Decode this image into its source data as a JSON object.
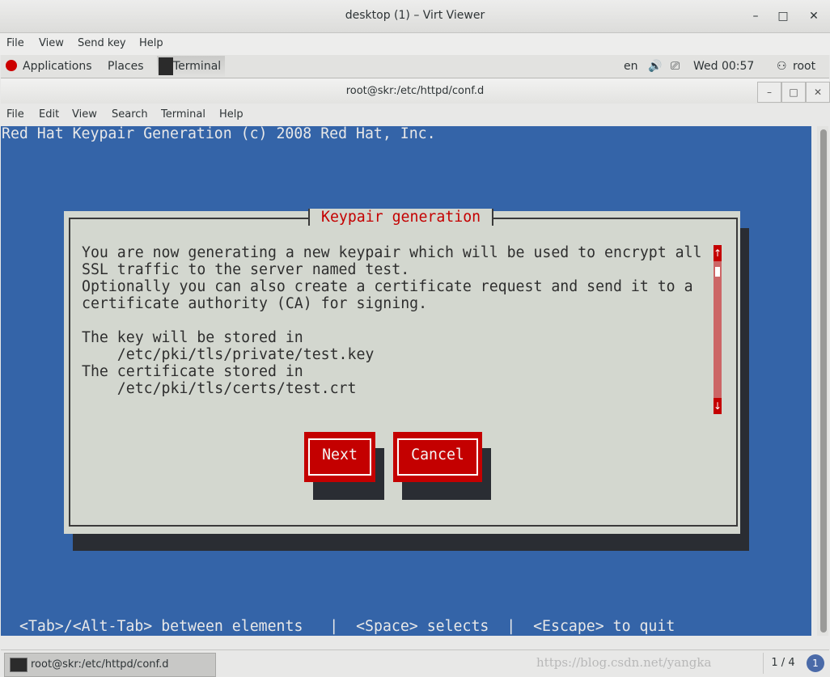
{
  "viewer": {
    "title": "desktop (1) – Virt Viewer",
    "menu": [
      "File",
      "View",
      "Send key",
      "Help"
    ]
  },
  "gnome_bar": {
    "applications": "Applications",
    "places": "Places",
    "task": "Terminal",
    "lang": "en",
    "clock": "Wed 00:57",
    "user": "root"
  },
  "terminal_window": {
    "title": "root@skr:/etc/httpd/conf.d",
    "menu": [
      "File",
      "Edit",
      "View",
      "Search",
      "Terminal",
      "Help"
    ]
  },
  "screen": {
    "header": "Red Hat Keypair Generation (c) 2008 Red Hat, Inc.",
    "dialog_title": "Keypair generation",
    "dialog_lines": [
      "You are now generating a new keypair which will be used to encrypt all",
      "SSL traffic to the server named test.",
      "Optionally you can also create a certificate request and send it to a",
      "certificate authority (CA) for signing.",
      "",
      "The key will be stored in",
      "    /etc/pki/tls/private/test.key",
      "The certificate stored in",
      "    /etc/pki/tls/certs/test.crt"
    ],
    "scroll_up": "↑",
    "scroll_down": "↓",
    "next_label": "Next",
    "cancel_label": "Cancel",
    "help_line": "<Tab>/<Alt-Tab> between elements   |  <Space> selects  |  <Escape> to quit"
  },
  "bottom_bar": {
    "task": "root@skr:/etc/httpd/conf.d",
    "watermark": "https://blog.csdn.net/yangka",
    "pager": "1 / 4",
    "info": "1"
  },
  "colors": {
    "terminal_bg": "#3464a8",
    "dialog_bg": "#d3d7cf",
    "accent_red": "#c40000"
  }
}
